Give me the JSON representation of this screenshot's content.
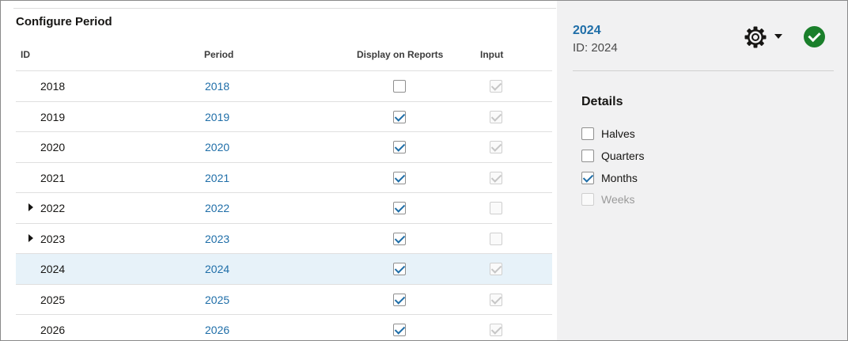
{
  "left_panel": {
    "title": "Configure Period",
    "columns": {
      "id": "ID",
      "period": "Period",
      "display": "Display on Reports",
      "input": "Input"
    },
    "rows": [
      {
        "id": "2018",
        "period": "2018",
        "display_on_reports": false,
        "input": true,
        "expandable": false,
        "selected": false
      },
      {
        "id": "2019",
        "period": "2019",
        "display_on_reports": true,
        "input": true,
        "expandable": false,
        "selected": false
      },
      {
        "id": "2020",
        "period": "2020",
        "display_on_reports": true,
        "input": true,
        "expandable": false,
        "selected": false
      },
      {
        "id": "2021",
        "period": "2021",
        "display_on_reports": true,
        "input": true,
        "expandable": false,
        "selected": false
      },
      {
        "id": "2022",
        "period": "2022",
        "display_on_reports": true,
        "input": false,
        "expandable": true,
        "selected": false
      },
      {
        "id": "2023",
        "period": "2023",
        "display_on_reports": true,
        "input": false,
        "expandable": true,
        "selected": false
      },
      {
        "id": "2024",
        "period": "2024",
        "display_on_reports": true,
        "input": true,
        "expandable": false,
        "selected": true
      },
      {
        "id": "2025",
        "period": "2025",
        "display_on_reports": true,
        "input": true,
        "expandable": false,
        "selected": false
      },
      {
        "id": "2026",
        "period": "2026",
        "display_on_reports": true,
        "input": true,
        "expandable": false,
        "selected": false
      }
    ]
  },
  "right_panel": {
    "title": "2024",
    "subtitle": "ID: 2024",
    "details_title": "Details",
    "details": [
      {
        "label": "Halves",
        "checked": false,
        "disabled": false
      },
      {
        "label": "Quarters",
        "checked": false,
        "disabled": false
      },
      {
        "label": "Months",
        "checked": true,
        "disabled": false
      },
      {
        "label": "Weeks",
        "checked": false,
        "disabled": true
      }
    ]
  },
  "colors": {
    "accent": "#1f6ea8",
    "success": "#1a7f2b",
    "selected_row": "#e7f2f9",
    "panel_bg": "#f1f1f2"
  },
  "icons": {
    "settings": "gear-icon",
    "menu": "chevron-down-icon",
    "confirm": "checkmark-circle-icon",
    "expand": "triangle-right-icon"
  }
}
